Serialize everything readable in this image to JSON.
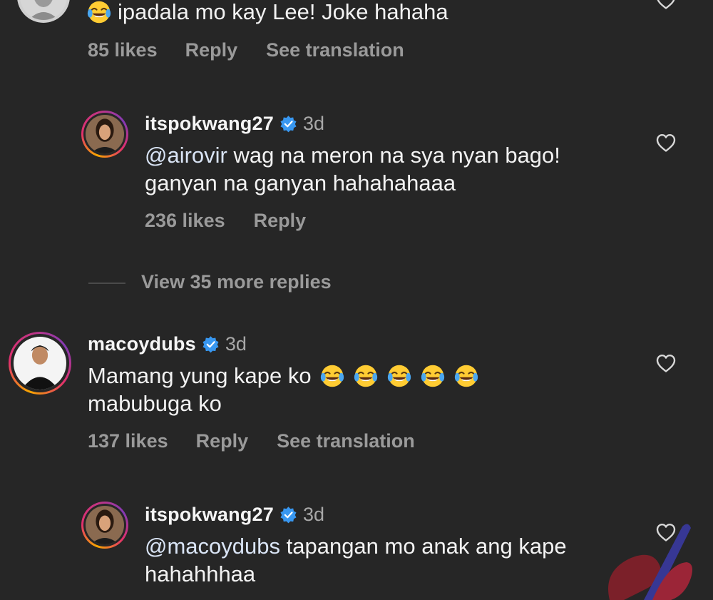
{
  "comments": [
    {
      "text": "ipadala mo kay Lee! Joke hahaha",
      "likes": "85 likes",
      "reply": "Reply",
      "translate": "See translation"
    },
    {
      "username": "itspokwang27",
      "time": "3d",
      "mention": "@airovir",
      "text_line1": " wag na meron na sya nyan bago!",
      "text_line2": "ganyan na ganyan hahahahaaa",
      "likes": "236 likes",
      "reply": "Reply"
    },
    {
      "view_more": "View 35 more replies"
    },
    {
      "username": "macoydubs",
      "time": "3d",
      "text_line1": "Mamang yung kape ko",
      "text_line2": "mabubuga ko",
      "emoji_count": 5,
      "likes": "137 likes",
      "reply": "Reply",
      "translate": "See translation"
    },
    {
      "username": "itspokwang27",
      "time": "3d",
      "mention": "@macoydubs",
      "text_line1": " tapangan mo anak ang kape",
      "text_line2": "hahahhhaa"
    }
  ],
  "icons": {
    "heart": "heart-outline-icon",
    "verified": "verified-badge-icon",
    "emoji": "face-with-tears-of-joy-emoji"
  },
  "colors": {
    "background": "#262626",
    "verified": "#3897f0",
    "muted": "#9a9a9a"
  }
}
